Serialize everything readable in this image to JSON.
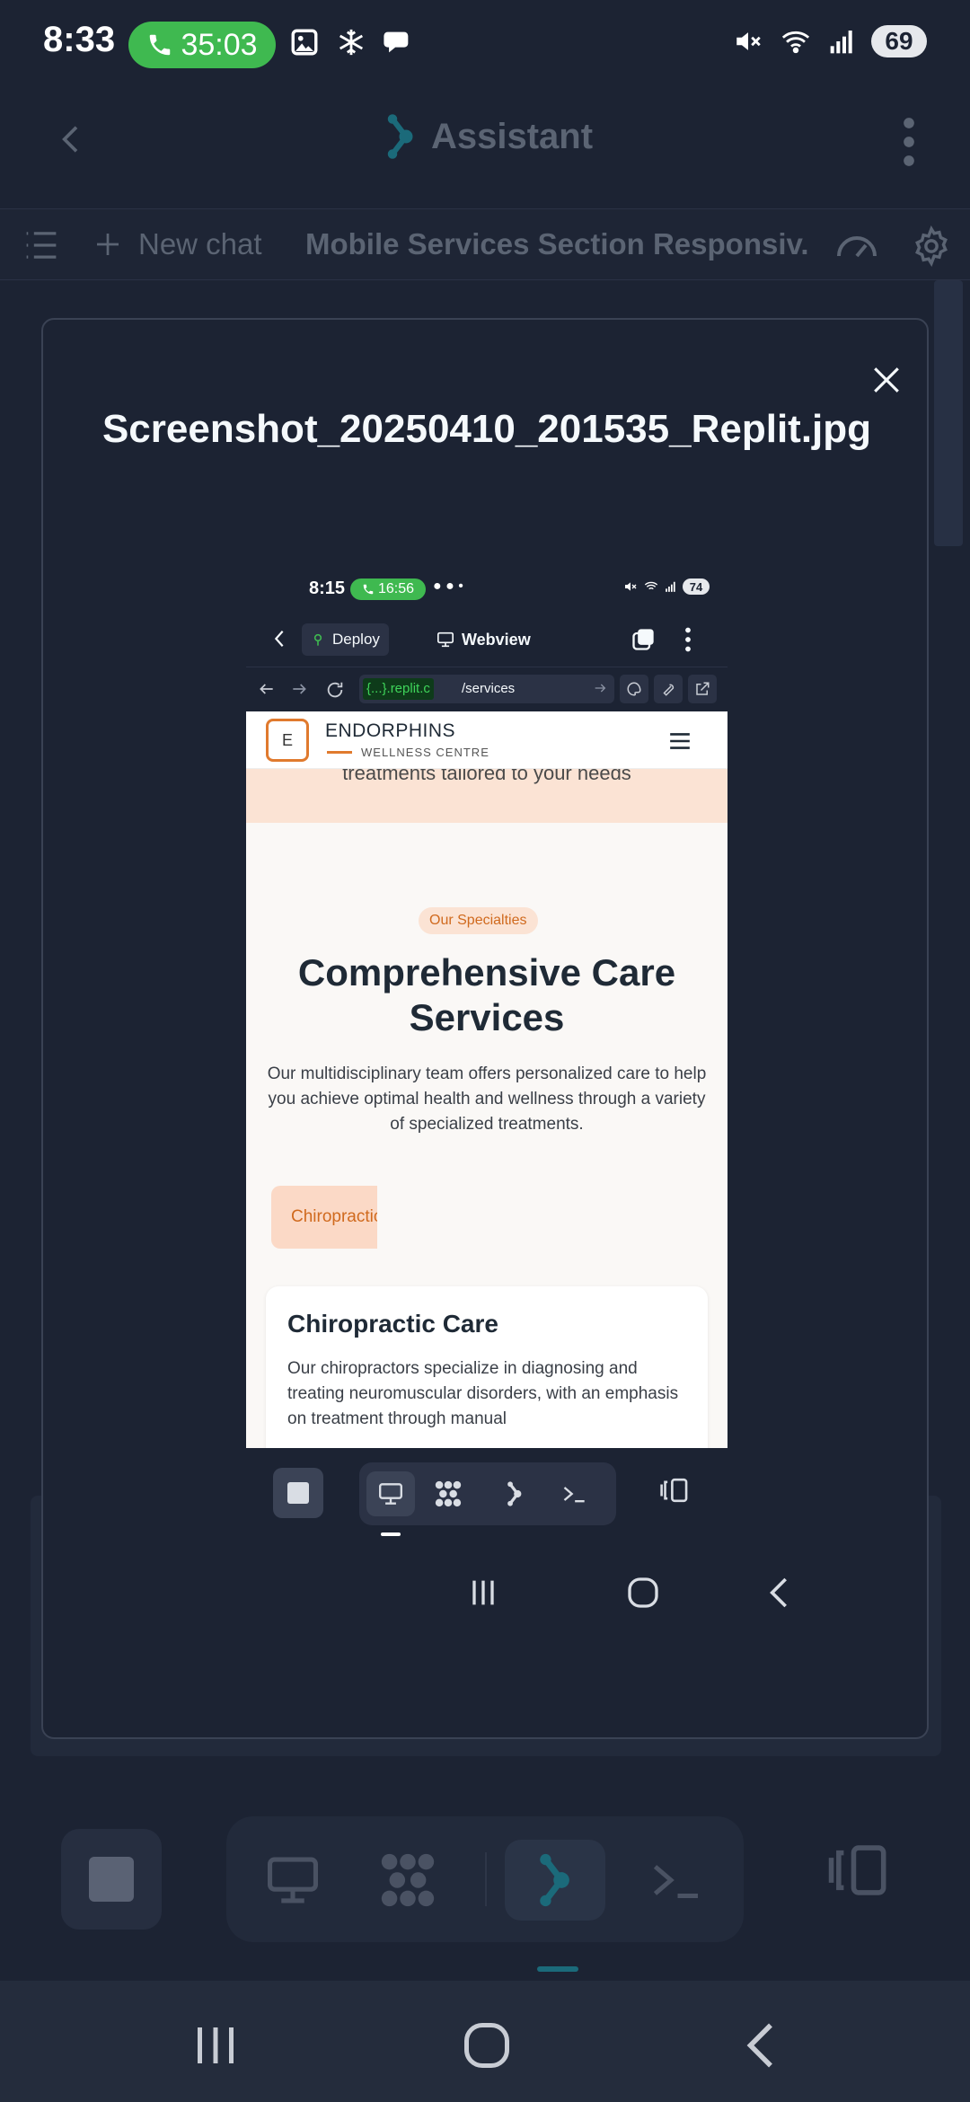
{
  "status_bar": {
    "time": "8:33",
    "call_timer": "35:03",
    "battery": "69"
  },
  "app_bar": {
    "title": "Assistant"
  },
  "tab_bar": {
    "new_chat_label": "New chat",
    "chat_title": "Mobile Services Section Responsiv..."
  },
  "modal": {
    "title": "Screenshot_20250410_201535_Replit.jpg",
    "screenshot": {
      "status": {
        "time": "8:15",
        "call_timer": "16:56",
        "battery": "74"
      },
      "app_bar": {
        "deploy_label": "Deploy",
        "webview_label": "Webview"
      },
      "url_bar": {
        "domain": "{...}.replit.c",
        "path": "/services"
      },
      "website": {
        "brand": "ENDORPHINS",
        "brand_subtitle": "WELLNESS CENTRE",
        "logo_letter": "E",
        "hero_fragment": "treatments tailored to your needs",
        "badge": "Our Specialties",
        "heading": "Comprehensive Care Services",
        "description": "Our multidisciplinary team offers personalized care to help you achieve optimal health and wellness through a variety of specialized treatments.",
        "active_tab": "Chiropractic Care",
        "card_title": "Chiropractic Care",
        "card_text": "Our chiropractors specialize in diagnosing and treating neuromuscular disorders, with an emphasis on treatment through manual"
      }
    }
  },
  "colors": {
    "background": "#1c2333",
    "accent": "#e07a2e",
    "call_green": "#3fb950"
  }
}
